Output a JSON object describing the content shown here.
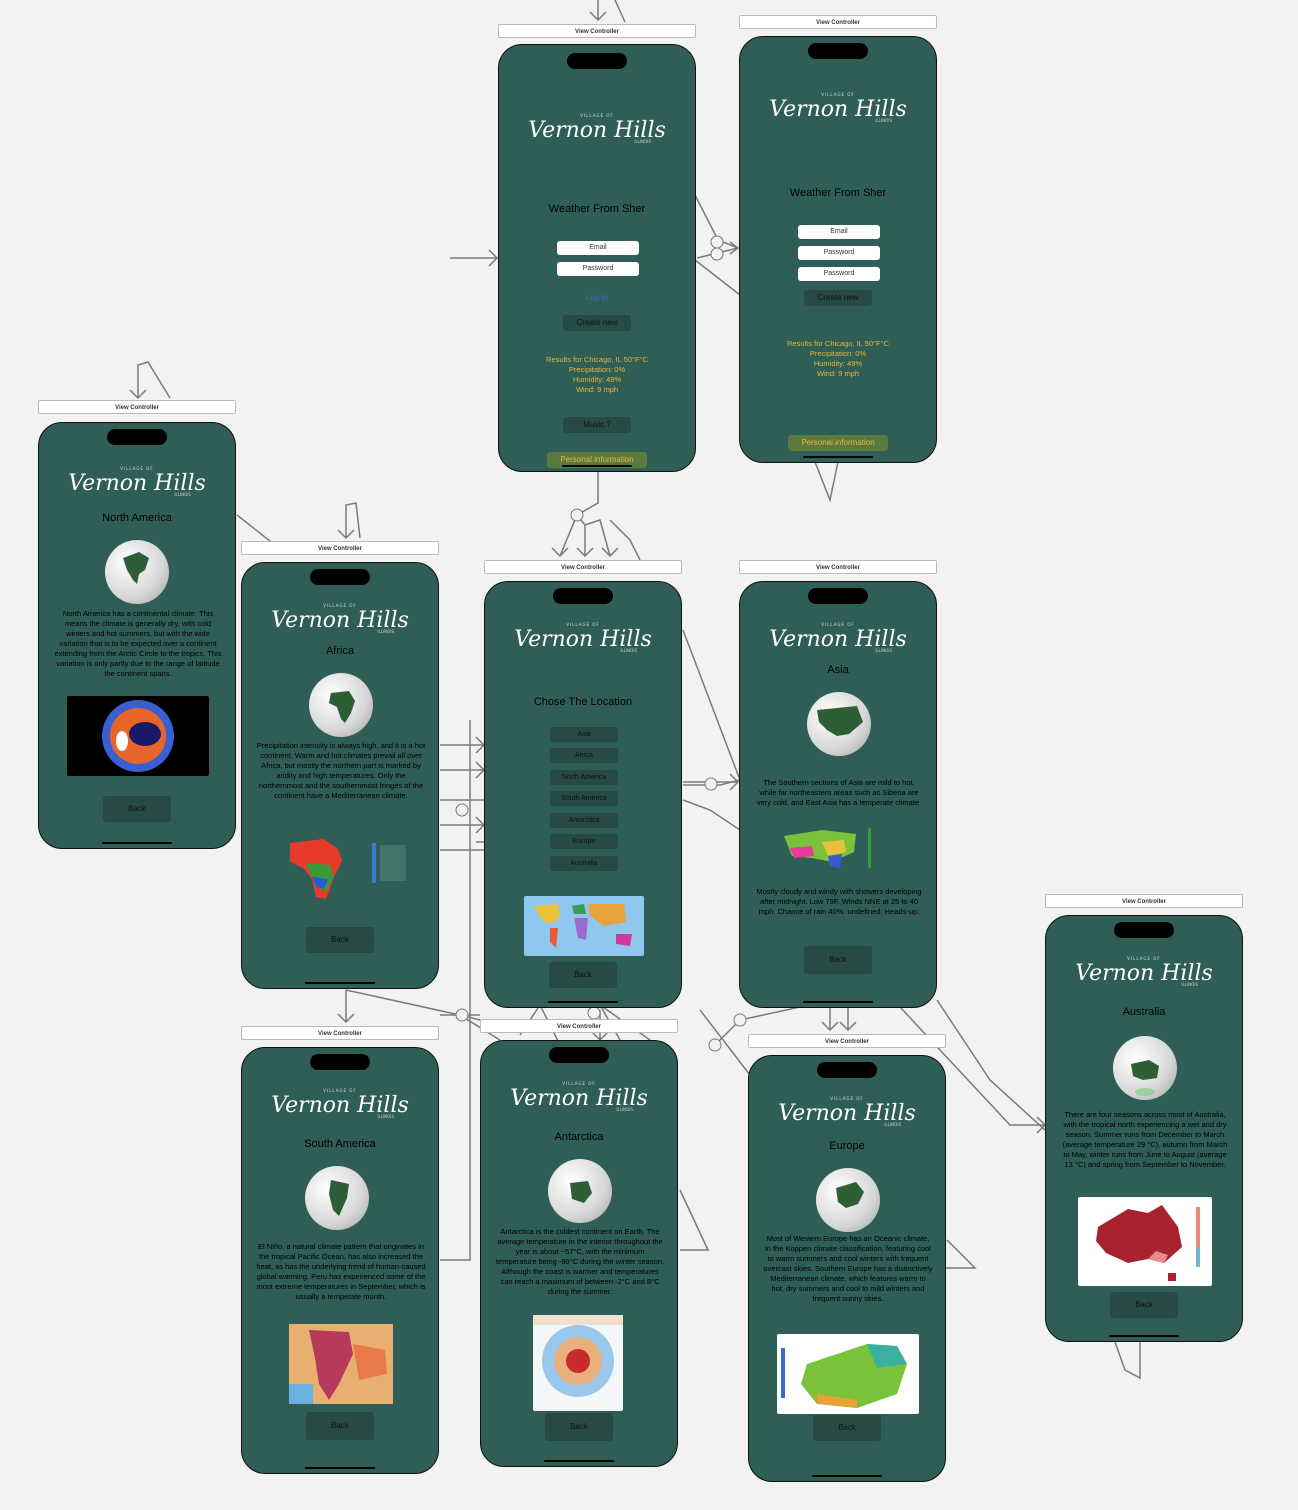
{
  "canvas": {
    "background": "#f2f2f2",
    "screen_color": "#2e5e55",
    "button_color": "#274b44",
    "weather_color": "#e8b53a"
  },
  "vc_label": "View Controller",
  "logo": {
    "small": "VILLAGE OF",
    "main": "Vernon Hills",
    "sub": "ILLINOIS"
  },
  "login": {
    "title": "Weather From Sher",
    "email_placeholder": "Email",
    "password_placeholder": "Password",
    "login_link": "Log In",
    "create_new": "Create new",
    "weather": [
      "Results for Chicago, IL 50°F°C",
      "Precipitation: 0%",
      "Humidity: 49%",
      "Wind: 9 mph"
    ],
    "music": "Music ?",
    "personal": "Personal information"
  },
  "signup": {
    "title": "Weather From Sher",
    "email_placeholder": "Email",
    "password_placeholder": "Password",
    "password2_placeholder": "Password",
    "create_new": "Create new",
    "weather": [
      "Results for Chicago, IL 50°F°C",
      "Precipitation: 0%",
      "Humidity: 49%",
      "Wind: 9 mph"
    ],
    "personal": "Personal information"
  },
  "location": {
    "title": "Chose The Location",
    "options": [
      "Asia",
      "Africa",
      "North America",
      "South America",
      "Antarctica",
      "Europe",
      "Australia"
    ],
    "back": "Back"
  },
  "north_america": {
    "title": "North America",
    "text": "North America has a continental climate. This means the climate is generally dry, with cold winters and hot summers, but with the wide variation that is to be expected over a continent extending from the Arctic Circle to the tropics. This variation is only partly due to the range of latitude the continent spans.",
    "back": "Back"
  },
  "africa": {
    "title": "Africa",
    "text": "Precipitation intensity is always high, and it is a hot continent. Warm and hot climates prevail all over Africa, but mostly the northern part is marked by aridity and high temperatures. Only the northernmost and the southernmost fringes of the continent have a Mediterranean climate.",
    "back": "Back"
  },
  "asia": {
    "title": "Asia",
    "text": "The Southern sections of Asia are mild to hot, while far northeastern areas such as Siberia are very cold, and East Asia has a temperate climate.",
    "forecast": "Mostly cloudy and windy with showers developing after midnight. Low 79F. Winds NNE at 25 to 40 mph. Chance of rain 40%. undefined. Heads-up.",
    "back": "Back"
  },
  "australia": {
    "title": "Australia",
    "text": "There are four seasons across most of Australia, with the tropical north experiencing a wet and dry season. Summer runs from December to March (average temperature 29 °C), autumn from March to May, winter runs from June to August (average 13 °C) and spring from September to November.",
    "back": "Back"
  },
  "south_america": {
    "title": "South America",
    "text": "El Niño, a natural climate pattern that originates in the tropical Pacific Ocean, has also increased the heat, as has the underlying trend of human-caused global warming. Peru has experienced some of the most extreme temperatures in September, which is usually a temperate month.",
    "back": "Back"
  },
  "antarctica": {
    "title": "Antarctica",
    "text": "Antarctica is the coldest continent on Earth. The average temperature in the interior throughout the year is about −57°C, with the minimum temperature being -90°C during the winter season. Although the coast is warmer and temperatures can reach a maximum of between -2°C and 8°C during the summer.",
    "back": "Back"
  },
  "europe": {
    "title": "Europe",
    "text": "Most of Western Europe has an Oceanic climate, in the Koppen climate classification, featuring cool to warm summers and cool winters with frequent overcast skies. Southern Europe has a distinctively Mediterranean climate, which features warm to hot, dry summers and cool to mild winters and frequent sunny skies.",
    "back": "Back"
  }
}
